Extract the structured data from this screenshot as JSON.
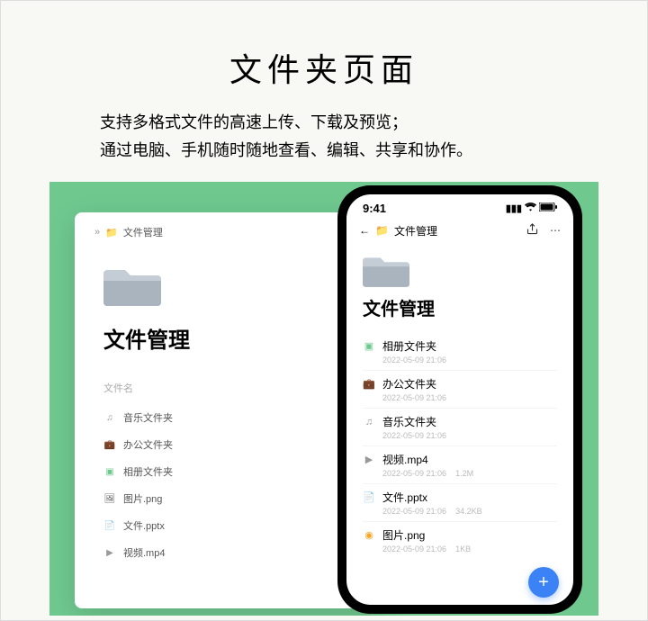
{
  "hero": {
    "title": "文件夹页面",
    "line1": "支持多格式文件的高速上传、下载及预览；",
    "line2": "通过电脑、手机随时随地查看、编辑、共享和协作。"
  },
  "desktop": {
    "breadcrumb_label": "文件管理",
    "title": "文件管理",
    "col_header": "文件名",
    "rows": [
      {
        "icon": "note",
        "name": "音乐文件夹"
      },
      {
        "icon": "bag",
        "name": "办公文件夹"
      },
      {
        "icon": "green",
        "name": "相册文件夹"
      },
      {
        "icon": "doc",
        "name": "图片.png"
      },
      {
        "icon": "doc",
        "name": "文件.pptx"
      },
      {
        "icon": "vid",
        "name": "视频.mp4"
      }
    ]
  },
  "phone": {
    "status_time": "9:41",
    "breadcrumb_label": "文件管理",
    "title": "文件管理",
    "rows": [
      {
        "icon": "green",
        "name": "相册文件夹",
        "date": "2022-05-09 21:06",
        "size": ""
      },
      {
        "icon": "bag",
        "name": "办公文件夹",
        "date": "2022-05-09 21:06",
        "size": ""
      },
      {
        "icon": "note",
        "name": "音乐文件夹",
        "date": "2022-05-09 21:06",
        "size": ""
      },
      {
        "icon": "vid",
        "name": "视频.mp4",
        "date": "2022-05-09 21:06",
        "size": "1.2M"
      },
      {
        "icon": "doc",
        "name": "文件.pptx",
        "date": "2022-05-09 21:06",
        "size": "34.2KB"
      },
      {
        "icon": "img",
        "name": "图片.png",
        "date": "2022-05-09 21:06",
        "size": "1KB"
      }
    ]
  }
}
